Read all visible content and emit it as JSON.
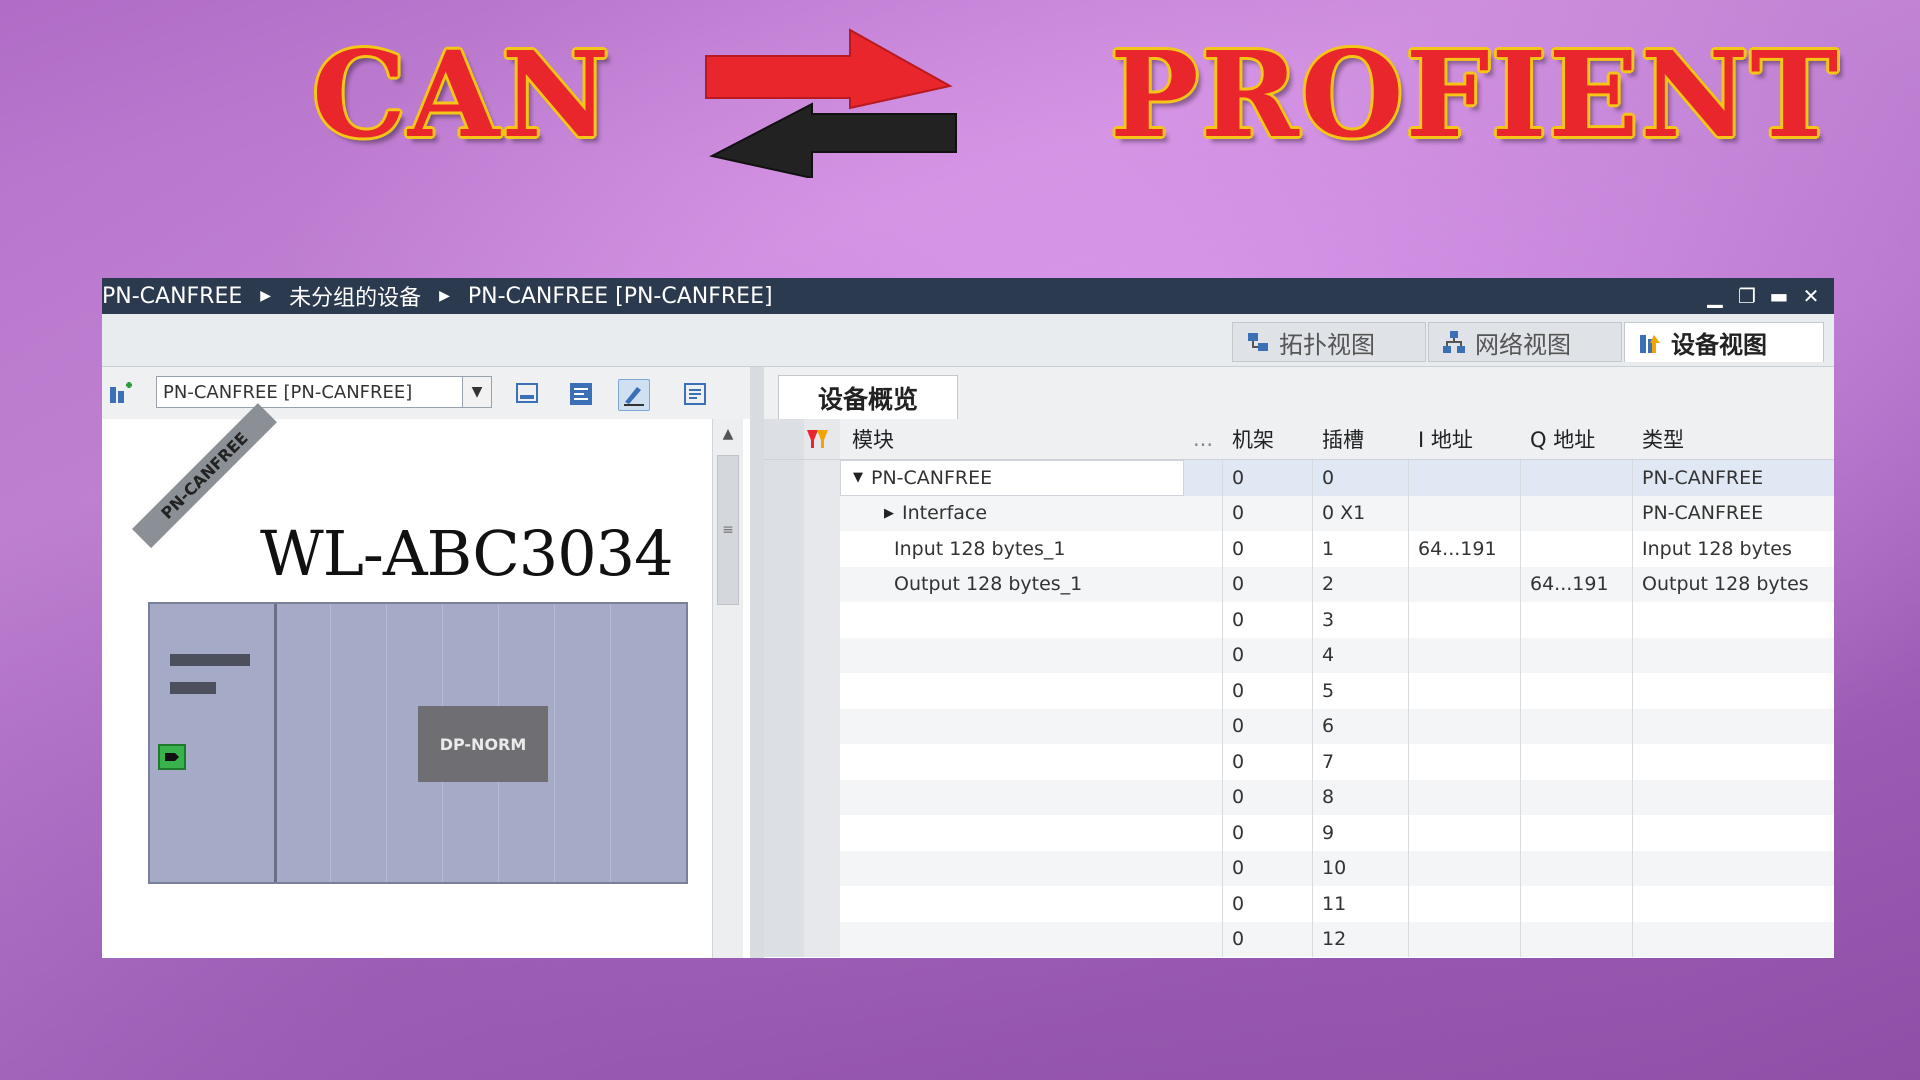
{
  "banner": {
    "left_title": "CAN",
    "right_title": "PROFIENT",
    "arrow_colors": {
      "top": "#e8262b",
      "bottom": "#222222"
    }
  },
  "window": {
    "breadcrumbs": [
      "PN-CANFREE",
      "未分组的设备",
      "PN-CANFREE [PN-CANFREE]"
    ],
    "controls": [
      "minimize-icon",
      "restore-icon",
      "maximize-icon",
      "close-icon"
    ],
    "view_tabs": [
      {
        "label": "拓扑视图",
        "icon": "topology-icon",
        "active": false
      },
      {
        "label": "网络视图",
        "icon": "network-icon",
        "active": false
      },
      {
        "label": "设备视图",
        "icon": "device-icon",
        "active": true
      }
    ]
  },
  "left_panel": {
    "device_select_value": "PN-CANFREE [PN-CANFREE]",
    "rack_label": "PN-CANFREE",
    "model_label": "WL-ABC3034",
    "module_label": "DP-NORM"
  },
  "right_panel": {
    "tab_label": "设备概览",
    "columns": {
      "module": "模块",
      "dots": "...",
      "rack": "机架",
      "slot": "插槽",
      "i_addr": "I 地址",
      "q_addr": "Q 地址",
      "type": "类型"
    },
    "rows": [
      {
        "module": "PN-CANFREE",
        "rack": "0",
        "slot": "0",
        "i_addr": "",
        "q_addr": "",
        "type": "PN-CANFREE",
        "expander": "▼"
      },
      {
        "module": "Interface",
        "rack": "0",
        "slot": "0 X1",
        "i_addr": "",
        "q_addr": "",
        "type": "PN-CANFREE",
        "expander": "▶"
      },
      {
        "module": "Input 128 bytes_1",
        "rack": "0",
        "slot": "1",
        "i_addr": "64...191",
        "q_addr": "",
        "type": "Input 128 bytes",
        "expander": ""
      },
      {
        "module": "Output 128 bytes_1",
        "rack": "0",
        "slot": "2",
        "i_addr": "",
        "q_addr": "64...191",
        "type": "Output 128 bytes",
        "expander": ""
      },
      {
        "module": "",
        "rack": "0",
        "slot": "3",
        "i_addr": "",
        "q_addr": "",
        "type": "",
        "expander": ""
      },
      {
        "module": "",
        "rack": "0",
        "slot": "4",
        "i_addr": "",
        "q_addr": "",
        "type": "",
        "expander": ""
      },
      {
        "module": "",
        "rack": "0",
        "slot": "5",
        "i_addr": "",
        "q_addr": "",
        "type": "",
        "expander": ""
      },
      {
        "module": "",
        "rack": "0",
        "slot": "6",
        "i_addr": "",
        "q_addr": "",
        "type": "",
        "expander": ""
      },
      {
        "module": "",
        "rack": "0",
        "slot": "7",
        "i_addr": "",
        "q_addr": "",
        "type": "",
        "expander": ""
      },
      {
        "module": "",
        "rack": "0",
        "slot": "8",
        "i_addr": "",
        "q_addr": "",
        "type": "",
        "expander": ""
      },
      {
        "module": "",
        "rack": "0",
        "slot": "9",
        "i_addr": "",
        "q_addr": "",
        "type": "",
        "expander": ""
      },
      {
        "module": "",
        "rack": "0",
        "slot": "10",
        "i_addr": "",
        "q_addr": "",
        "type": "",
        "expander": ""
      },
      {
        "module": "",
        "rack": "0",
        "slot": "11",
        "i_addr": "",
        "q_addr": "",
        "type": "",
        "expander": ""
      },
      {
        "module": "",
        "rack": "0",
        "slot": "12",
        "i_addr": "",
        "q_addr": "",
        "type": "",
        "expander": ""
      }
    ]
  }
}
